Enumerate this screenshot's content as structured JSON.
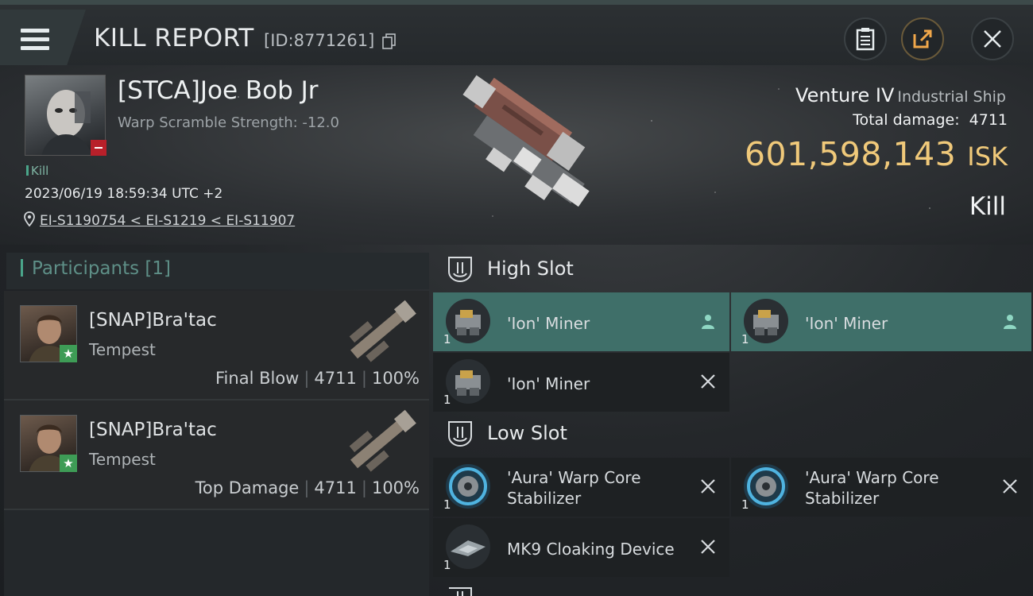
{
  "header": {
    "title": "KILL REPORT",
    "report_id": "[ID:8771261]"
  },
  "victim": {
    "name": "[STCA]Joe Bob Jr",
    "subtitle": "Warp Scramble Strength: -12.0",
    "result_tag": "Kill",
    "datetime": "2023/06/19 18:59:34 UTC +2",
    "location": "EI-S1190754 < EI-S1219 < EI-S11907",
    "ship_name": "Venture IV",
    "ship_class": "Industrial Ship",
    "total_damage_label": "Total damage:",
    "total_damage": "4711",
    "isk_value": "601,598,143",
    "isk_unit": "ISK",
    "outcome": "Kill"
  },
  "participants": {
    "title": "Participants",
    "count": "[1]",
    "rows": [
      {
        "name": "[SNAP]Bra'tac",
        "ship": "Tempest",
        "role": "Final Blow",
        "damage": "4711",
        "percent": "100%"
      },
      {
        "name": "[SNAP]Bra'tac",
        "ship": "Tempest",
        "role": "Top Damage",
        "damage": "4711",
        "percent": "100%"
      }
    ]
  },
  "fitting": {
    "high_slot": {
      "title": "High Slot",
      "modules": [
        {
          "qty": "1",
          "label": "'Ion' Miner",
          "status": "dropped"
        },
        {
          "qty": "1",
          "label": "'Ion' Miner",
          "status": "dropped"
        },
        {
          "qty": "1",
          "label": "'Ion' Miner",
          "status": "destroyed"
        }
      ]
    },
    "low_slot": {
      "title": "Low Slot",
      "modules": [
        {
          "qty": "1",
          "label_line1": "'Aura' Warp Core",
          "label_line2": "Stabilizer",
          "status": "destroyed"
        },
        {
          "qty": "1",
          "label_line1": "'Aura' Warp Core",
          "label_line2": "Stabilizer",
          "status": "destroyed"
        },
        {
          "qty": "1",
          "label": "MK9 Cloaking Device",
          "status": "destroyed"
        }
      ]
    }
  },
  "colors": {
    "accent_teal": "#4aa58a",
    "highlight_row": "#3f6f69",
    "isk_gold": "#f0c97a",
    "loss_red": "#b8202a"
  },
  "icons": [
    "menu-icon",
    "copy-icon",
    "clipboard-icon",
    "share-icon",
    "close-icon",
    "location-pin-icon",
    "slot-icon",
    "person-icon",
    "x-icon"
  ]
}
